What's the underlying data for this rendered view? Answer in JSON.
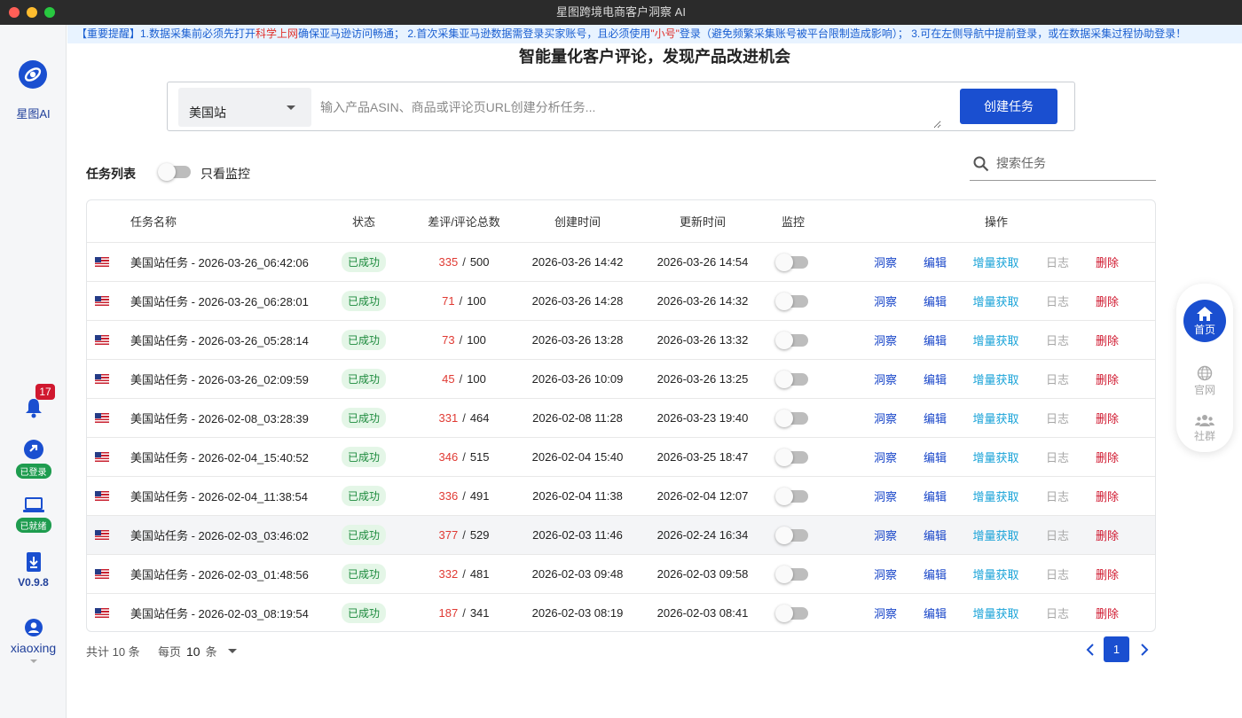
{
  "window": {
    "title": "星图跨境电商客户洞察 AI"
  },
  "sidebar": {
    "logo_label": "星图AI",
    "notification_count": "17",
    "login_status": "已登录",
    "device_status": "已就绪",
    "version": "V0.9.8",
    "username": "xiaoxing"
  },
  "notice": {
    "part1": "【重要提醒】1.数据采集前必须先打开",
    "highlight1": "科学上网",
    "part2": "确保亚马逊访问畅通； 2.首次采集亚马逊数据需登录买家账号，且必须使用",
    "highlight2": "\"小号\"",
    "part3": "登录（避免频繁采集账号被平台限制造成影响）； 3.可在左侧导航中提前登录，或在数据采集过程协助登录！"
  },
  "heading": "智能量化客户评论，发现产品改进机会",
  "create": {
    "site": "美国站",
    "placeholder": "输入产品ASIN、商品或评论页URL创建分析任务...",
    "button": "创建任务"
  },
  "list": {
    "title": "任务列表",
    "monitor_only_label": "只看监控",
    "search_placeholder": "搜索任务"
  },
  "table": {
    "headers": {
      "name": "任务名称",
      "status": "状态",
      "count": "差评/评论总数",
      "created": "创建时间",
      "updated": "更新时间",
      "monitor": "监控",
      "ops": "操作"
    },
    "actions": {
      "insight": "洞察",
      "edit": "编辑",
      "incremental": "增量获取",
      "log": "日志",
      "delete": "删除"
    },
    "rows": [
      {
        "name": "美国站任务 - 2026-03-26_06:42:06",
        "status": "已成功",
        "bad": "335",
        "total": "500",
        "created": "2026-03-26 14:42",
        "updated": "2026-03-26 14:54"
      },
      {
        "name": "美国站任务 - 2026-03-26_06:28:01",
        "status": "已成功",
        "bad": "71",
        "total": "100",
        "created": "2026-03-26 14:28",
        "updated": "2026-03-26 14:32"
      },
      {
        "name": "美国站任务 - 2026-03-26_05:28:14",
        "status": "已成功",
        "bad": "73",
        "total": "100",
        "created": "2026-03-26 13:28",
        "updated": "2026-03-26 13:32"
      },
      {
        "name": "美国站任务 - 2026-03-26_02:09:59",
        "status": "已成功",
        "bad": "45",
        "total": "100",
        "created": "2026-03-26 10:09",
        "updated": "2026-03-26 13:25"
      },
      {
        "name": "美国站任务 - 2026-02-08_03:28:39",
        "status": "已成功",
        "bad": "331",
        "total": "464",
        "created": "2026-02-08 11:28",
        "updated": "2026-03-23 19:40"
      },
      {
        "name": "美国站任务 - 2026-02-04_15:40:52",
        "status": "已成功",
        "bad": "346",
        "total": "515",
        "created": "2026-02-04 15:40",
        "updated": "2026-03-25 18:47"
      },
      {
        "name": "美国站任务 - 2026-02-04_11:38:54",
        "status": "已成功",
        "bad": "336",
        "total": "491",
        "created": "2026-02-04 11:38",
        "updated": "2026-02-04 12:07"
      },
      {
        "name": "美国站任务 - 2026-02-03_03:46:02",
        "status": "已成功",
        "bad": "377",
        "total": "529",
        "created": "2026-02-03 11:46",
        "updated": "2026-02-24 16:34"
      },
      {
        "name": "美国站任务 - 2026-02-03_01:48:56",
        "status": "已成功",
        "bad": "332",
        "total": "481",
        "created": "2026-02-03 09:48",
        "updated": "2026-02-03 09:58"
      },
      {
        "name": "美国站任务 - 2026-02-03_08:19:54",
        "status": "已成功",
        "bad": "187",
        "total": "341",
        "created": "2026-02-03 08:19",
        "updated": "2026-02-03 08:41"
      }
    ]
  },
  "pagination": {
    "total": "共计 10 条",
    "per_page_prefix": "每页",
    "per_page_value": "10",
    "per_page_suffix": "条",
    "current_page": "1"
  },
  "dock": {
    "home": "首页",
    "website": "官网",
    "community": "社群"
  },
  "colors": {
    "primary": "#1a4fd0",
    "danger": "#d0182f",
    "success": "#1c8a3c",
    "info": "#1aa3d8"
  }
}
